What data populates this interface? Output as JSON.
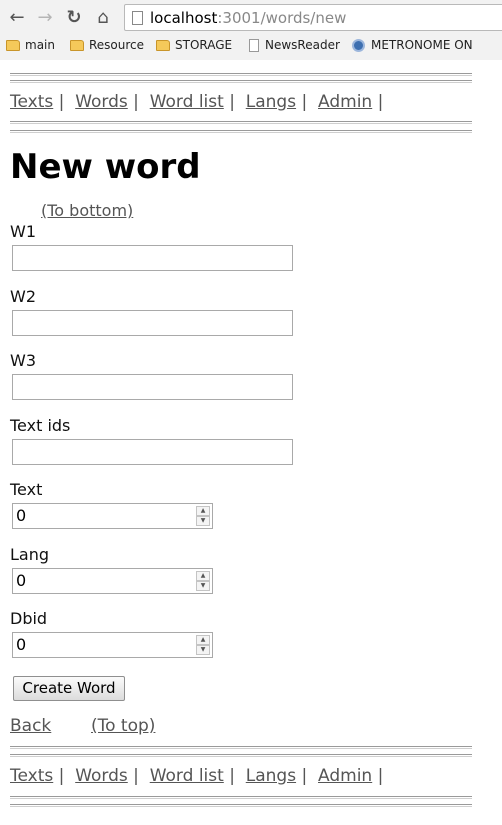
{
  "browser": {
    "url_host": "localhost",
    "url_rest": ":3001/words/new",
    "bookmarks": [
      "main",
      "Resource",
      "STORAGE",
      "NewsReader",
      "METRONOME ON"
    ]
  },
  "menu": {
    "items": [
      "Texts",
      "Words",
      "Word list",
      "Langs",
      "Admin"
    ],
    "separator": "|"
  },
  "page": {
    "title": "New word",
    "to_bottom": "(To bottom)",
    "to_top": "(To top)",
    "back": "Back"
  },
  "form": {
    "w1_label": "W1",
    "w2_label": "W2",
    "w3_label": "W3",
    "text_ids_label": "Text ids",
    "text_label": "Text",
    "text_value": "0",
    "lang_label": "Lang",
    "lang_value": "0",
    "dbid_label": "Dbid",
    "dbid_value": "0",
    "submit_label": "Create Word"
  },
  "icons": {
    "back": "arrow-left",
    "forward": "arrow-right",
    "reload": "reload",
    "home": "home"
  }
}
